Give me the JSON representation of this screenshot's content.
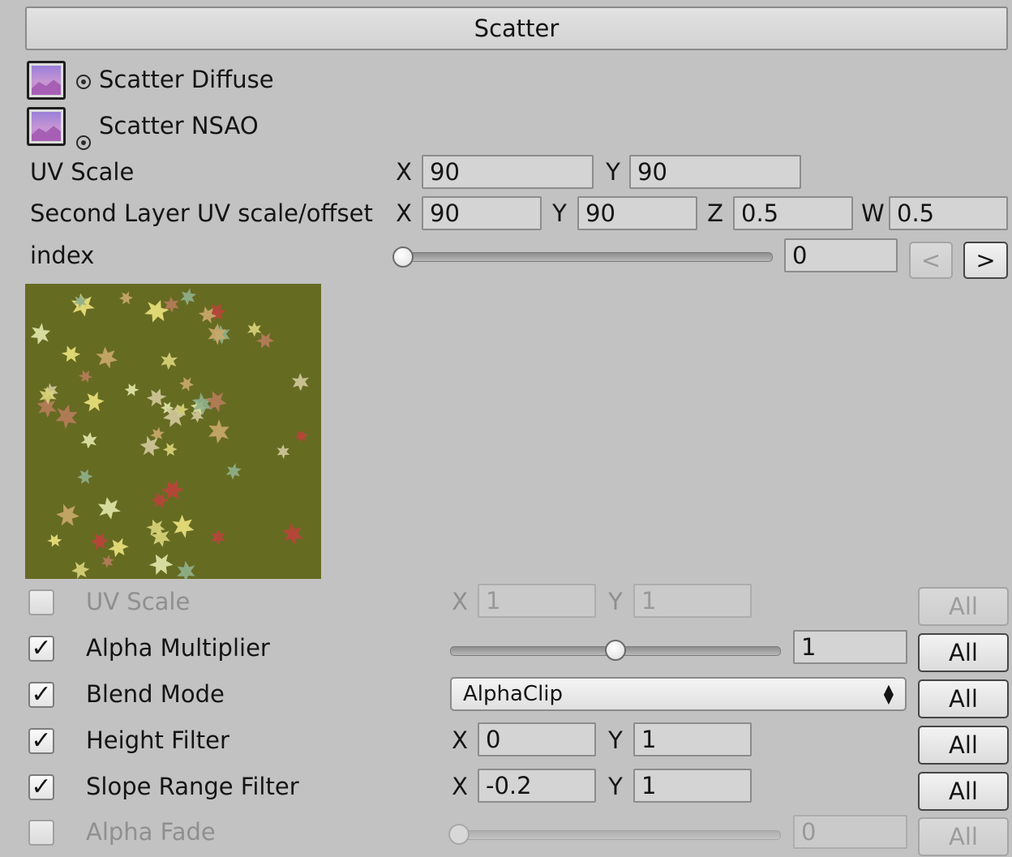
{
  "header": {
    "title": "Scatter"
  },
  "textures": [
    {
      "label": "Scatter Diffuse",
      "icon": "texture-thumbnail"
    },
    {
      "label": "Scatter NSAO",
      "icon": "texture-thumbnail"
    }
  ],
  "uv_scale": {
    "label": "UV Scale",
    "x_axis": "X",
    "y_axis": "Y",
    "x": "90",
    "y": "90"
  },
  "second_layer": {
    "label": "Second Layer UV scale/offset",
    "x_axis": "X",
    "y_axis": "Y",
    "z_axis": "Z",
    "w_axis": "W",
    "x": "90",
    "y": "90",
    "z": "0.5",
    "w": "0.5"
  },
  "index": {
    "label": "index",
    "value": "0",
    "slider_fraction": 0,
    "prev_label": "<",
    "next_label": ">"
  },
  "preview": {
    "background_color": "#666b22"
  },
  "properties": {
    "uv_scale": {
      "label": "UV Scale",
      "checked": false,
      "x_axis": "X",
      "y_axis": "Y",
      "x": "1",
      "y": "1",
      "all_label": "All"
    },
    "alpha_multiplier": {
      "label": "Alpha Multiplier",
      "checked": true,
      "value": "1",
      "slider_fraction": 0.5,
      "all_label": "All"
    },
    "blend_mode": {
      "label": "Blend Mode",
      "checked": true,
      "selected": "AlphaClip",
      "all_label": "All"
    },
    "height_filter": {
      "label": "Height Filter",
      "checked": true,
      "x_axis": "X",
      "y_axis": "Y",
      "x": "0",
      "y": "1",
      "all_label": "All"
    },
    "slope_range_filter": {
      "label": "Slope Range Filter",
      "checked": true,
      "x_axis": "X",
      "y_axis": "Y",
      "x": "-0.2",
      "y": "1",
      "all_label": "All"
    },
    "alpha_fade": {
      "label": "Alpha Fade",
      "checked": false,
      "value": "0",
      "slider_fraction": 0,
      "all_label": "All"
    }
  },
  "colors": {
    "panel_bg": "#c2c2c2",
    "field_bg": "#d4d4d4",
    "disabled_text": "#8f8f8f"
  }
}
